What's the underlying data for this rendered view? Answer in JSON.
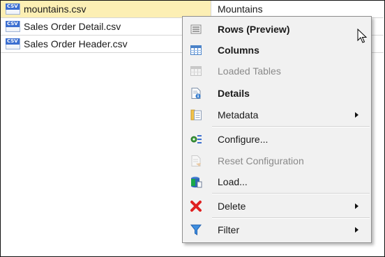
{
  "files": [
    {
      "name": "mountains.csv",
      "description": "Mountains",
      "icon": "csv-file-icon",
      "selected": true
    },
    {
      "name": "Sales Order Detail.csv",
      "description": "",
      "icon": "csv-file-icon",
      "selected": false
    },
    {
      "name": "Sales Order Header.csv",
      "description": "",
      "icon": "csv-file-icon",
      "selected": false
    }
  ],
  "file_icon_tag": "CSV",
  "context_menu": {
    "items": [
      {
        "label": "Rows (Preview)",
        "icon": "rows-preview-icon",
        "bold": true,
        "enabled": true,
        "submenu": false
      },
      {
        "label": "Columns",
        "icon": "columns-icon",
        "bold": true,
        "enabled": true,
        "submenu": false
      },
      {
        "label": "Loaded Tables",
        "icon": "loaded-tables-icon",
        "bold": false,
        "enabled": false,
        "submenu": false
      },
      {
        "label": "Details",
        "icon": "details-icon",
        "bold": true,
        "enabled": true,
        "submenu": false
      },
      {
        "label": "Metadata",
        "icon": "metadata-icon",
        "bold": false,
        "enabled": true,
        "submenu": true
      },
      {
        "label": "Configure...",
        "icon": "configure-icon",
        "bold": false,
        "enabled": true,
        "submenu": false
      },
      {
        "label": "Reset Configuration",
        "icon": "reset-configuration-icon",
        "bold": false,
        "enabled": false,
        "submenu": false
      },
      {
        "label": "Load...",
        "icon": "load-icon",
        "bold": false,
        "enabled": true,
        "submenu": false
      },
      {
        "label": "Delete",
        "icon": "delete-icon",
        "bold": false,
        "enabled": true,
        "submenu": true
      },
      {
        "label": "Filter",
        "icon": "filter-icon",
        "bold": false,
        "enabled": true,
        "submenu": true
      }
    ]
  },
  "colors": {
    "selected_row": "#fcefb4",
    "menu_background": "#f1f1f1",
    "disabled_text": "#8a8a8a",
    "delete_red": "#e02020",
    "icon_blue": "#3c6fd1"
  }
}
